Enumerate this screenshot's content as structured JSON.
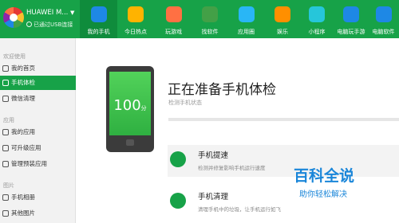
{
  "device": {
    "name": "HUAWEI M...",
    "status": "已通过USB连接"
  },
  "nav": [
    {
      "label": "我的手机",
      "icon": "phone-icon",
      "color": "#1e88e5",
      "active": true
    },
    {
      "label": "今日热点",
      "icon": "star-icon",
      "color": "#ffb300"
    },
    {
      "label": "玩游戏",
      "icon": "gamepad-icon",
      "color": "#ff7043"
    },
    {
      "label": "找软件",
      "icon": "android-icon",
      "color": "#43a047"
    },
    {
      "label": "应用圈",
      "icon": "circle-icon",
      "color": "#29b6f6"
    },
    {
      "label": "娱乐",
      "icon": "gift-icon",
      "color": "#ff8f00"
    },
    {
      "label": "小程序",
      "icon": "miniapp-icon",
      "color": "#26c6da"
    },
    {
      "label": "电脑玩手游",
      "icon": "controller-icon",
      "color": "#1e88e5"
    },
    {
      "label": "电脑软件",
      "icon": "grid-icon",
      "color": "#1e88e5"
    }
  ],
  "sidebar": {
    "sections": [
      {
        "title": "欢迎使用",
        "items": [
          {
            "label": "我的首页",
            "icon": "home-icon"
          },
          {
            "label": "手机体检",
            "icon": "checkup-icon",
            "active": true
          },
          {
            "label": "微信清理",
            "icon": "wechat-icon"
          }
        ]
      },
      {
        "title": "应用",
        "items": [
          {
            "label": "我的应用",
            "icon": "apps-icon"
          },
          {
            "label": "可升级应用",
            "icon": "upgrade-icon"
          },
          {
            "label": "管理预装应用",
            "icon": "preinstall-icon"
          }
        ]
      },
      {
        "title": "图片",
        "items": [
          {
            "label": "手机相册",
            "icon": "camera-icon"
          },
          {
            "label": "其他图片",
            "icon": "image-icon"
          }
        ]
      }
    ]
  },
  "main": {
    "score": "100",
    "score_unit": "分",
    "title": "正在准备手机体检",
    "subtitle": "检测手机状态",
    "progress": 0,
    "cards": [
      {
        "title": "手机提速",
        "desc": "检测并修复影响手机运行速度",
        "icon": "rocket-icon"
      },
      {
        "title": "手机清理",
        "desc": "清理手机中的垃圾，让手机运行如飞",
        "icon": "broom-icon"
      }
    ]
  },
  "watermark": {
    "big": "百科全说",
    "small": "助你轻松解决"
  }
}
